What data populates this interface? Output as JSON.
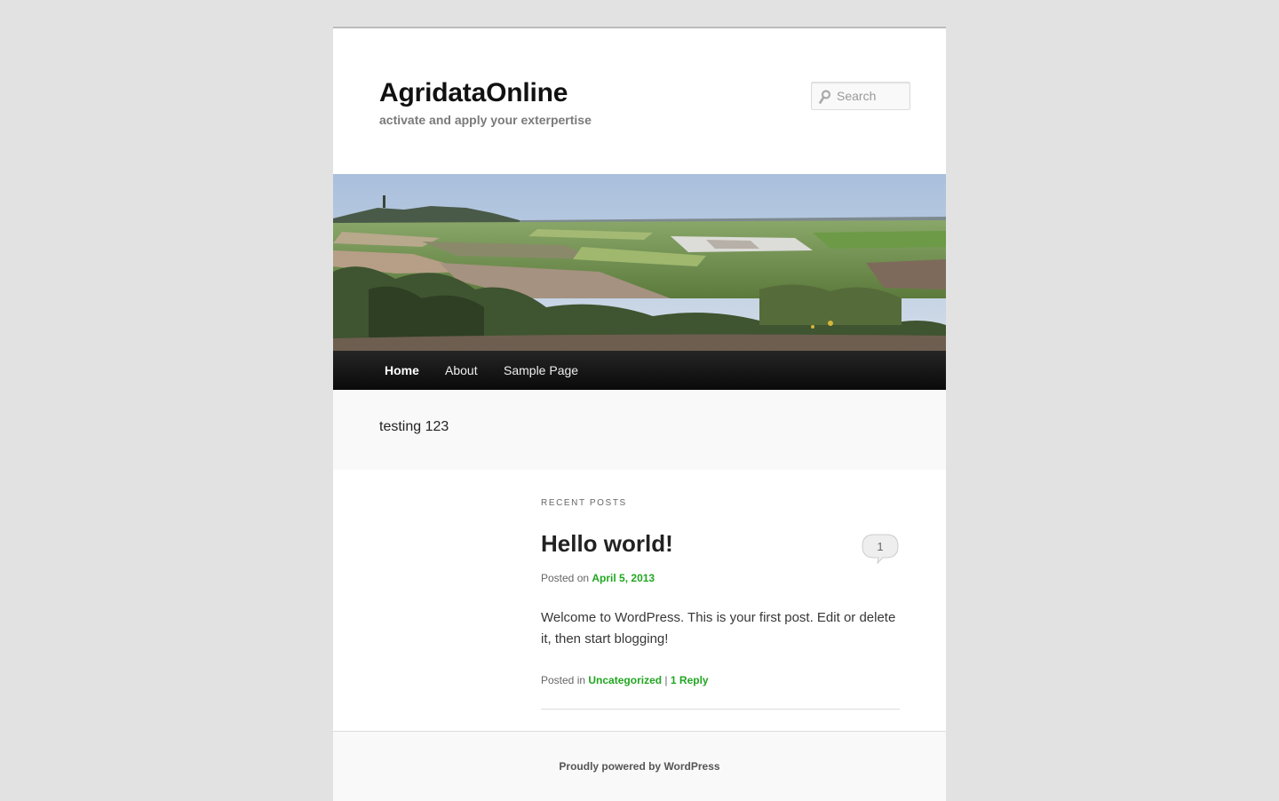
{
  "site": {
    "title": "AgridataOnline",
    "description": "activate and apply your exterpertise"
  },
  "search": {
    "placeholder": "Search",
    "icon": "search-icon"
  },
  "nav": {
    "items": [
      {
        "label": "Home",
        "current": true
      },
      {
        "label": "About",
        "current": false
      },
      {
        "label": "Sample Page",
        "current": false
      }
    ]
  },
  "showcase": {
    "text": "testing 123"
  },
  "recent": {
    "heading": "Recent Posts",
    "post": {
      "title": "Hello world!",
      "comment_count": "1",
      "posted_on_label": "Posted on",
      "date": "April 5, 2013",
      "excerpt": "Welcome to WordPress. This is your first post. Edit or delete it, then start blogging!",
      "posted_in_label": "Posted in",
      "category": "Uncategorized",
      "separator": "|",
      "replies": "1 Reply"
    }
  },
  "footer": {
    "credit": "Proudly powered by WordPress"
  },
  "colors": {
    "link": "#22a622",
    "background": "#e2e2e2",
    "nav_bg": "#1a1a1a"
  }
}
